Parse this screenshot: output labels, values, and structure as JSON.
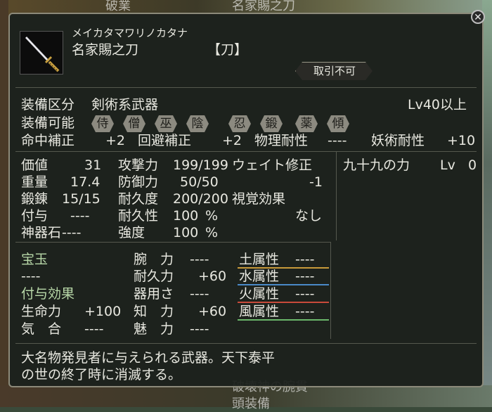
{
  "background": {
    "top_text_left": "破業",
    "top_text_right": "名家賜之刀",
    "bottom_text": "破壊神の腕貫",
    "bottom_text2": "頭装備"
  },
  "item": {
    "reading": "メイカタマワリノカタナ",
    "name": "名家賜之刀",
    "category": "【刀】",
    "trade_status": "取引不可"
  },
  "equip": {
    "class_label": "装備区分",
    "class_value": "剣術系武器",
    "level_req": "Lv40以上",
    "usable_label": "装備可能",
    "usable_classes": [
      "侍",
      "僧",
      "巫",
      "陰",
      "忍",
      "鍛",
      "薬",
      "傾"
    ]
  },
  "bonuses": {
    "hit_label": "命中補正",
    "hit_value": "+2",
    "evade_label": "回避補正",
    "evade_value": "+2",
    "phys_res_label": "物理耐性",
    "phys_res_value": "----",
    "mystic_res_label": "妖術耐性",
    "mystic_res_value": "+10"
  },
  "stats_left": [
    {
      "label": "価値",
      "value": "31"
    },
    {
      "label": "重量",
      "value": "17.4"
    },
    {
      "label": "鍛錬",
      "value": "15/15"
    },
    {
      "label": "付与",
      "value": "----"
    },
    {
      "label": "神器石",
      "value": "----"
    }
  ],
  "stats_mid": [
    {
      "label": "攻撃力",
      "value": "199/199"
    },
    {
      "label": "防御力",
      "value": "50/50"
    },
    {
      "label": "耐久度",
      "value": "200/200"
    },
    {
      "label": "耐久性",
      "value": "100",
      "unit": "%"
    },
    {
      "label": "強度",
      "value": "100",
      "unit": "%"
    }
  ],
  "weight_correction": {
    "label": "ウェイト修正",
    "value": "-1"
  },
  "visual_effect": {
    "label": "視覚効果",
    "value": "なし"
  },
  "skill": {
    "name": "九十九の力",
    "level_label": "Lv",
    "level_value": "0"
  },
  "gem": {
    "label": "宝玉",
    "value": "----"
  },
  "enchant_label": "付与効果",
  "attrs_left": [
    {
      "label": "生命力",
      "value": "+100"
    },
    {
      "label": "気　合",
      "value": "----"
    }
  ],
  "attrs_mid": [
    {
      "label": "腕　力",
      "value": "----"
    },
    {
      "label": "耐久力",
      "value": "+60"
    },
    {
      "label": "器用さ",
      "value": "----"
    },
    {
      "label": "知　力",
      "value": "+60"
    },
    {
      "label": "魅　力",
      "value": "----"
    }
  ],
  "elements": [
    {
      "label": "土属性",
      "value": "----",
      "color": "#c89a3a"
    },
    {
      "label": "水属性",
      "value": "----",
      "color": "#4a8ac8"
    },
    {
      "label": "火属性",
      "value": "----",
      "color": "#c84a3a"
    },
    {
      "label": "風属性",
      "value": "----",
      "color": "#6ab86a"
    }
  ],
  "description": {
    "line1": "大名物発見者に与えられる武器。天下泰平",
    "line2": "の世の終了時に消滅する。"
  }
}
